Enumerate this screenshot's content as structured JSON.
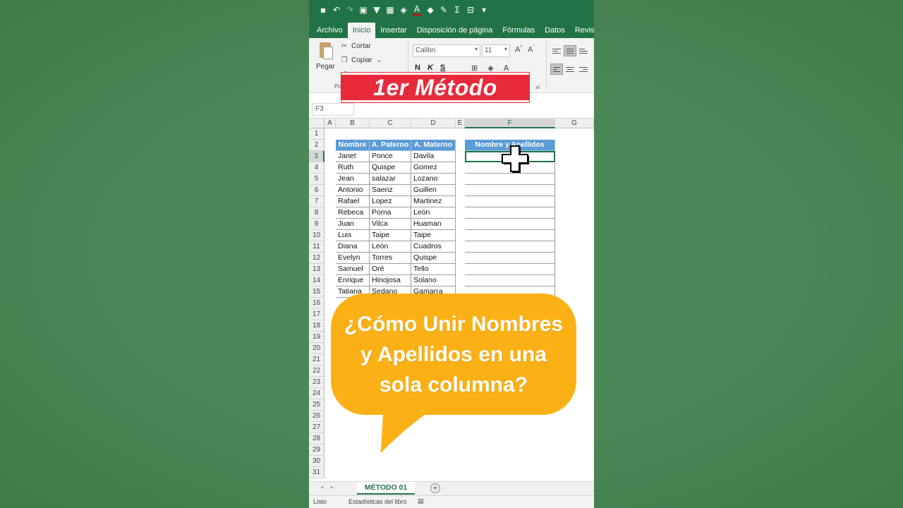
{
  "qat": {
    "icons": [
      "save-icon",
      "undo-icon",
      "redo-icon",
      "camera-icon",
      "filter-icon",
      "grid-icon",
      "fill-color-icon",
      "font-color-icon",
      "eraser-icon",
      "paint-brush-icon",
      "sum-icon",
      "insert-icon",
      "more-icon"
    ]
  },
  "ribbon_tabs": [
    "Archivo",
    "Inicio",
    "Insertar",
    "Disposición de página",
    "Fórmulas",
    "Datos",
    "Revisar"
  ],
  "ribbon": {
    "paste_label": "Pegar",
    "cut_label": "Cortar",
    "copy_label": "Copiar",
    "group_label_partial": "Po",
    "font_name": "Calibri",
    "font_size": "11",
    "bold": "N",
    "italic": "K",
    "underline": "S"
  },
  "banner": {
    "text": "1er Método"
  },
  "formula_bar": {
    "name_box": "F3"
  },
  "columns": [
    "A",
    "B",
    "C",
    "D",
    "E",
    "F",
    "G"
  ],
  "rows": [
    "1",
    "2",
    "3",
    "4",
    "5",
    "6",
    "7",
    "8",
    "9",
    "10",
    "11",
    "12",
    "13",
    "14",
    "15",
    "16",
    "17",
    "18",
    "19",
    "20",
    "21",
    "22",
    "23",
    "24",
    "25",
    "26",
    "27",
    "28",
    "29",
    "30",
    "31"
  ],
  "table": {
    "headers": [
      "Nombre",
      "A. Paterno",
      "A. Materno"
    ],
    "result_header": "Nombre y Apellidos",
    "rows": [
      [
        "Janet",
        "Ponce",
        "Davila"
      ],
      [
        "Ruth",
        "Quispe",
        "Gomez"
      ],
      [
        "Jean",
        "salazar",
        "Lozano"
      ],
      [
        "Antonio",
        "Saenz",
        "Guillen"
      ],
      [
        "Rafael",
        "Lopez",
        "Martinez"
      ],
      [
        "Rebeca",
        "Poma",
        "León"
      ],
      [
        "Juan",
        "Vilca",
        "Huaman"
      ],
      [
        "Luis",
        "Taipe",
        "Taipe"
      ],
      [
        "Diana",
        "León",
        "Cuadros"
      ],
      [
        "Evelyn",
        "Torres",
        "Quispe"
      ],
      [
        "Samuel",
        "Oré",
        "Tello"
      ],
      [
        "Enrique",
        "Hinojosa",
        "Solano"
      ],
      [
        "Tatiana",
        "Sedano",
        "Gamarra"
      ]
    ]
  },
  "bubble": {
    "text": "¿Cómo Unir Nombres y Apellidos en una sola columna?"
  },
  "sheet_tab": "MÉTODO 01",
  "status": {
    "ready": "Listo",
    "stats": "Estadísticas del libro"
  },
  "colors": {
    "excel_green": "#217346",
    "header_blue": "#5b9bd5",
    "banner_red": "#e8293a",
    "bubble_orange": "#fbb116"
  }
}
